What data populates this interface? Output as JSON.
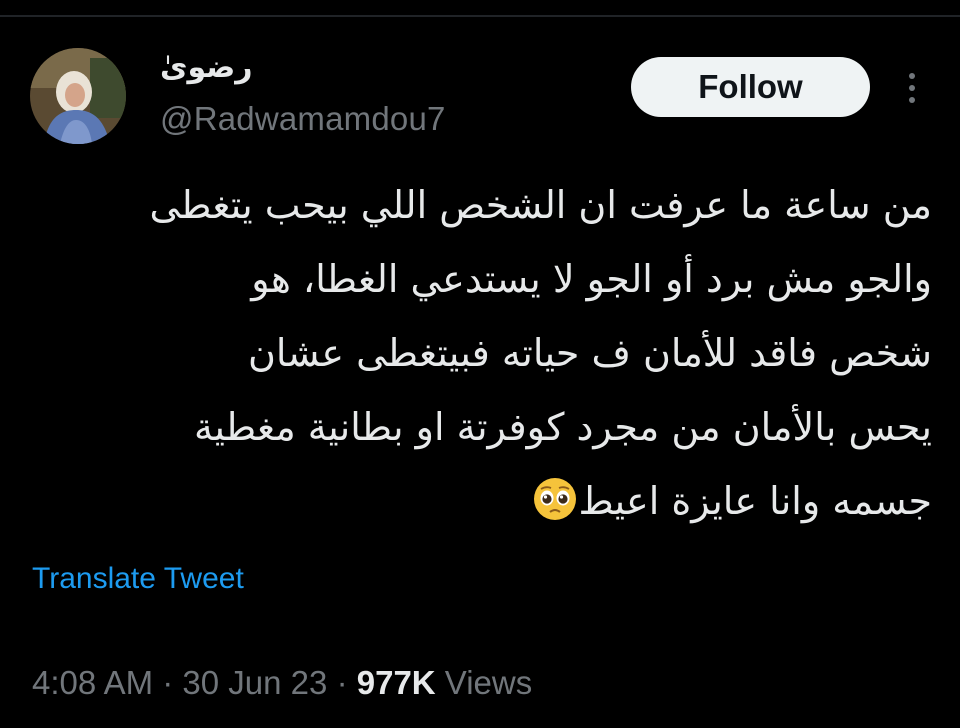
{
  "tweet": {
    "author": {
      "display_name": "رضوىٰ",
      "handle": "@Radwamamdou7"
    },
    "follow_label": "Follow",
    "more_icon": "more-vertical-icon",
    "text_lines": [
      "من ساعة ما عرفت ان الشخص اللي بيحب يتغطى",
      "والجو مش برد أو الجو لا يستدعي الغطا، هو",
      "شخص فاقد للأمان ف حياته فبيتغطى عشان",
      "يحس بالأمان من مجرد كوفرتة او بطانية مغطية",
      "جسمه وانا عايزة اعيط"
    ],
    "emoji": "pleading-face-emoji",
    "translate_label": "Translate Tweet",
    "time": "4:08 AM",
    "separator": "·",
    "date": "30 Jun 23",
    "views_count": "977K",
    "views_label": "Views"
  },
  "colors": {
    "background": "#000000",
    "text": "#e7e9ea",
    "muted": "#71767b",
    "link": "#1d9bf0",
    "button_bg": "#eff3f4"
  }
}
